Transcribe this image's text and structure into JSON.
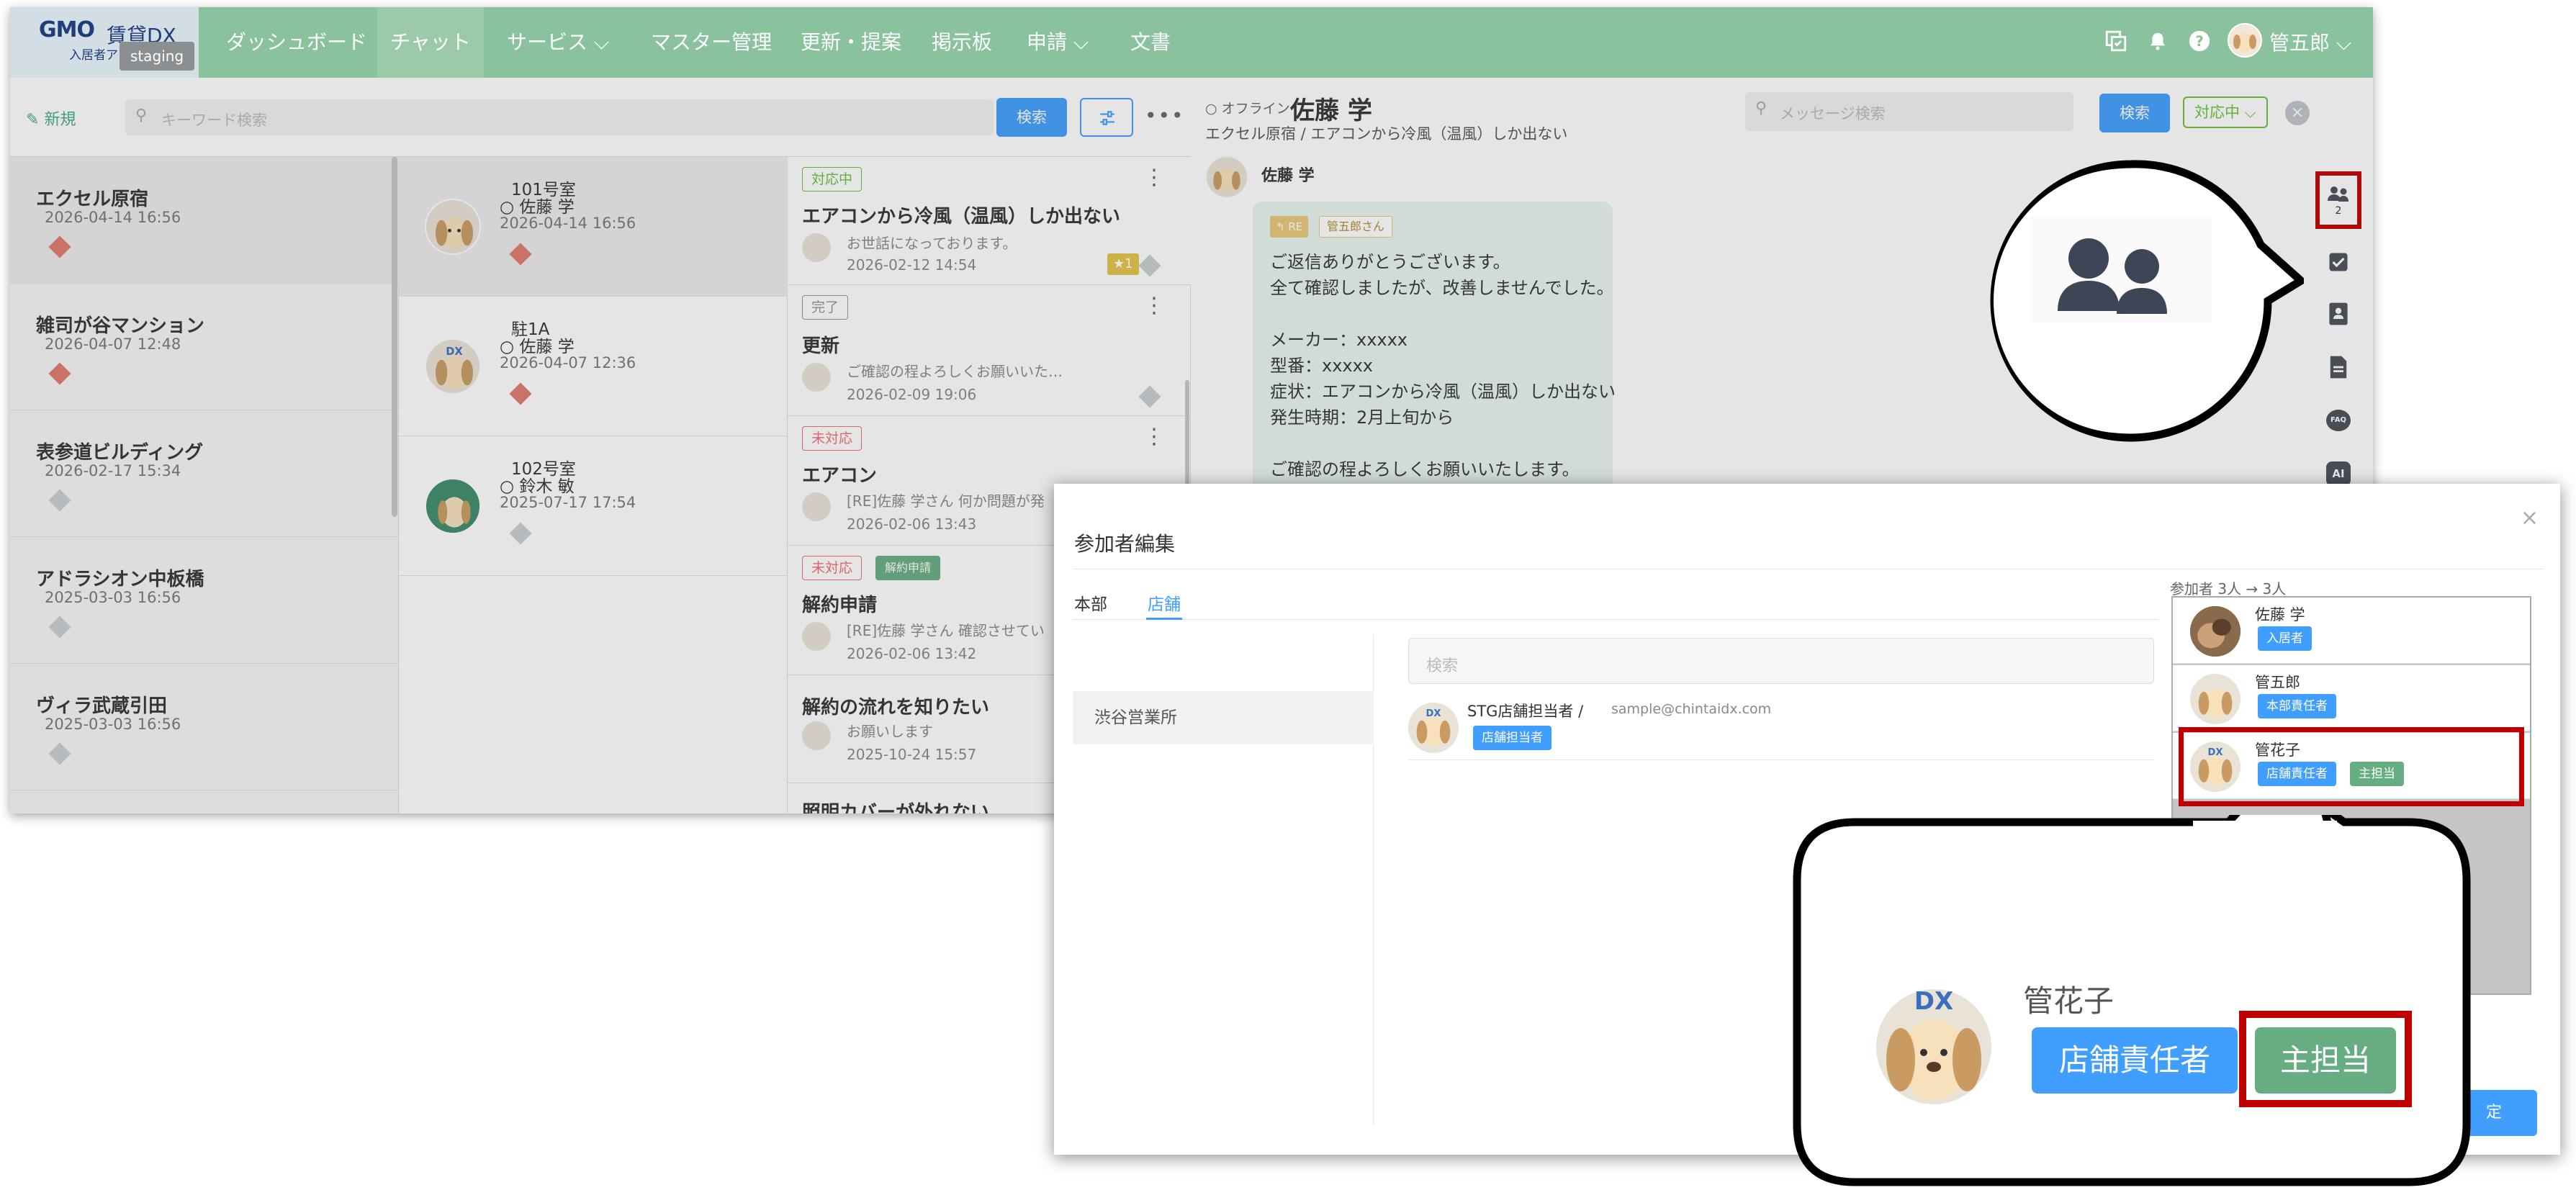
{
  "app": {
    "logo": {
      "brand": "GMO",
      "product": "賃貸DX",
      "subtitle": "入居者アプ",
      "env_badge": "staging"
    },
    "nav": {
      "items": [
        {
          "label": "ダッシュボード"
        },
        {
          "label": "チャット"
        },
        {
          "label": "サービス ⌵"
        },
        {
          "label": "マスター管理"
        },
        {
          "label": "更新・提案"
        },
        {
          "label": "掲示板"
        },
        {
          "label": "申請 ⌵"
        },
        {
          "label": "文書"
        }
      ],
      "user_name": "管五郎 ⌵"
    },
    "toolbar": {
      "new_label": "新規",
      "search_placeholder": "キーワード検索",
      "search_button": "検索",
      "more": "•••"
    },
    "buildings": [
      {
        "name": "エクセル原宿",
        "date": "2026-04-14 16:56"
      },
      {
        "name": "雑司が谷マンション",
        "date": "2026-04-07 12:48"
      },
      {
        "name": "表参道ビルディング",
        "date": "2026-02-17 15:34"
      },
      {
        "name": "アドラシオン中板橋",
        "date": "2025-03-03 16:56"
      },
      {
        "name": "ヴィラ武蔵引田",
        "date": "2025-03-03 16:56"
      }
    ],
    "rooms": [
      {
        "room": "101号室",
        "resident": "○ 佐藤 学",
        "date": "2026-04-14 16:56"
      },
      {
        "room": "駐1A",
        "resident": "○ 佐藤 学",
        "date": "2026-04-07 12:36"
      },
      {
        "room": "102号室",
        "resident": "○ 鈴木 敏",
        "date": "2025-07-17 17:54"
      }
    ],
    "threads": [
      {
        "status": "対応中",
        "title": "エアコンから冷風（温風）しか出ない",
        "snippet": "お世話になっております。",
        "date": "2026-02-12 14:54",
        "star": "★1"
      },
      {
        "status": "完了",
        "title": "更新",
        "snippet": "ご確認の程よろしくお願いいた…",
        "date": "2026-02-09 19:06"
      },
      {
        "status": "未対応",
        "title": "エアコン",
        "snippet": "[RE]佐藤 学さん 何か問題が発",
        "date": "2026-02-06 13:43"
      },
      {
        "status": "未対応",
        "status2": "解約申請",
        "title": "解約申請",
        "snippet": "[RE]佐藤 学さん 確認させてい",
        "date": "2026-02-06 13:42"
      },
      {
        "title": "解約の流れを知りたい",
        "snippet": "お願いします",
        "date": "2025-10-24 15:57"
      },
      {
        "title": "照明カバーが外れない"
      }
    ],
    "chat": {
      "presence": "○ オフライン",
      "header_name": "佐藤 学",
      "subject": "エクセル原宿 / エアコンから冷風（温風）しか出ない",
      "msg_search_placeholder": "メッセージ検索",
      "search_button": "検索",
      "status_select": "対応中 ⌵",
      "sender": "佐藤 学",
      "reply_tag": "↰ RE",
      "reply_to": "管五郎さん",
      "message_lines": [
        "ご返信ありがとうございます。",
        "全て確認しましたが、改善しませんでした。",
        "",
        "メーカー：xxxxx",
        "型番：xxxxx",
        "症状：エアコンから冷風（温風）しか出ない",
        "発生時期：2月上旬から",
        "",
        "ご確認の程よろしくお願いいたします。"
      ],
      "participant_count": "2",
      "side_icons": [
        "participants-icon",
        "checkbox-icon",
        "contact-card-icon",
        "document-icon",
        "faq-icon",
        "ai-icon"
      ],
      "faq_label": "FAQ",
      "ai_label": "AI"
    }
  },
  "modal": {
    "title": "参加者編集",
    "close": "×",
    "tabs": [
      {
        "label": "本部"
      },
      {
        "label": "店舗"
      }
    ],
    "active_tab": "店舗",
    "stores": [
      {
        "name": "渋谷営業所"
      }
    ],
    "search_placeholder": "検索",
    "candidates": [
      {
        "name": "STG店舗担当者 /",
        "email": "sample@chintaidx.com",
        "role": "店舗担当者"
      }
    ],
    "participants_label": "参加者 3人 → 3人",
    "participants": [
      {
        "name": "佐藤 学",
        "roles": [
          "入居者"
        ]
      },
      {
        "name": "管五郎",
        "roles": [
          "本部責任者"
        ]
      },
      {
        "name": "管花子",
        "roles": [
          "店舗責任者",
          "主担当"
        ]
      }
    ],
    "ok_label": "定"
  },
  "callout_zoom": {
    "name": "管花子",
    "role": "店舗責任者",
    "main_tag": "主担当"
  },
  "colors": {
    "nav_green": "#89c29c",
    "accent_blue": "#409eff",
    "tag_green": "#67ad82",
    "highlight_red": "#c00000",
    "status_in_progress": "#67c23a",
    "status_unhandled": "#f56c6c",
    "status_done": "#909399"
  }
}
